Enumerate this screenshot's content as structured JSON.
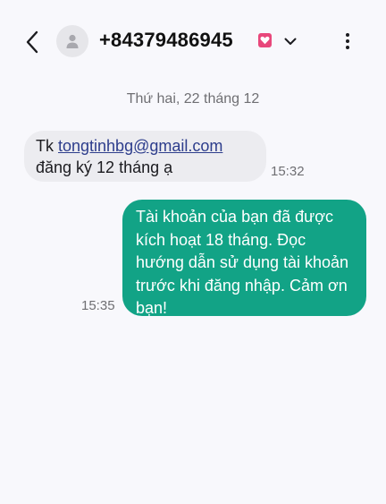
{
  "header": {
    "back_icon": "chevron-left-icon",
    "avatar_icon": "person-icon",
    "contact_number": "+84379486945",
    "badge_icon": "heart-badge-icon",
    "dropdown_icon": "chevron-down-icon",
    "more_icon": "more-vertical-icon"
  },
  "conversation": {
    "date_separator": "Thứ hai, 22 tháng 12",
    "messages": [
      {
        "direction": "incoming",
        "prefix": "Tk ",
        "email": "tongtinhbg@gmail.com",
        "line2": "đăng ký 12 tháng ạ",
        "time": "15:32"
      },
      {
        "direction": "outgoing",
        "lines": [
          "Tài khoản của bạn đã được",
          "kích hoạt 18 tháng. Đọc",
          "hướng dẫn sử dụng tài khoản",
          "trước khi đăng nhập. Cảm ơn",
          "bạn!"
        ],
        "time": "15:35"
      }
    ]
  },
  "colors": {
    "background": "#f8f8fc",
    "incoming_bubble": "#ececf0",
    "outgoing_bubble": "#12a386",
    "link": "#2d3d8c",
    "badge": "#e8477b"
  }
}
